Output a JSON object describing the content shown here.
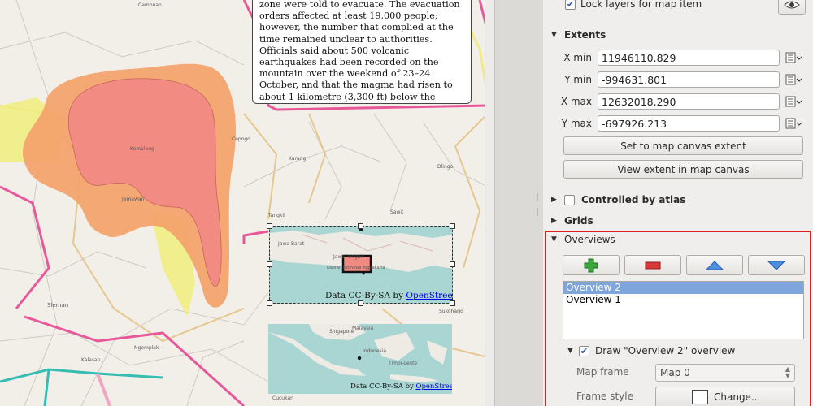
{
  "map": {
    "textbox_text": "zone were told to evacuate. The evacuation orders affected at least 19,000 people; however, the number that complied at the time remained unclear to authorities. Officials said about 500 volcanic earthquakes had been recorded on the mountain over the weekend of 23–24 October, and that the magma had risen to about 1 kilometre (3,300 ft) below the surface due to the seismic activity. - http://en.wikipedia.org/wiki/Mount_Merapi",
    "overview1_credit_prefix": "Data CC-By-SA by ",
    "overview1_credit_link": "OpenStreetMap",
    "overview2_credit_prefix": "Data CC-By-SA by ",
    "overview2_credit_link": "OpenStreetMap",
    "place_labels": [
      "Cambuan",
      "Cepogo",
      "Sleman",
      "Karang",
      "Dlingo",
      "Tangkil",
      "Kemalang",
      "Jemawan",
      "Ngemplak",
      "Sukoharjo",
      "Sawit",
      "Kalasan",
      "Cucukan"
    ],
    "overview1_labels": [
      "Jawa Barat",
      "Jawa Tengah",
      "Daerah Istimewa Yogyakarta"
    ],
    "overview2_labels": [
      "Singapore",
      "Malaysia",
      "Indonesia",
      "Timor-Leste"
    ],
    "colors": {
      "hazard_inner": "#f28b84",
      "hazard_outer": "#f3a36d",
      "hazard_yellow": "#f1ee7d",
      "road_primary": "#e8579a",
      "sea": "#a9d6d3"
    }
  },
  "panel": {
    "lock_layers_label": "Lock layers for map item",
    "extents_heading": "Extents",
    "xmin_label": "X min",
    "xmin_value": "11946110.829",
    "ymin_label": "Y min",
    "ymin_value": "-994631.801",
    "xmax_label": "X max",
    "xmax_value": "12632018.290",
    "ymax_label": "Y max",
    "ymax_value": "-697926.213",
    "set_extent_button": "Set to map canvas extent",
    "view_extent_button": "View extent in map canvas",
    "controlled_by_atlas_label": "Controlled by atlas",
    "grids_heading": "Grids",
    "overviews_heading": "Overviews",
    "overview_list": [
      "Overview 2",
      "Overview 1"
    ],
    "draw_overview_label": "Draw \"Overview 2\" overview",
    "map_frame_label": "Map frame",
    "map_frame_value": "Map 0",
    "frame_style_label": "Frame style",
    "change_button": "Change..."
  }
}
